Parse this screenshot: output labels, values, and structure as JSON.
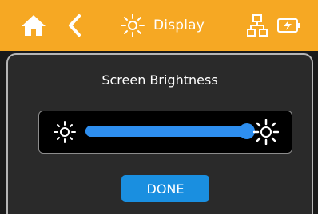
{
  "header": {
    "title": "Display",
    "home_icon": "home-icon",
    "back_icon": "back-chevron-icon",
    "title_icon": "sun-icon",
    "network_icon": "network-icon",
    "battery_icon": "battery-charging-icon"
  },
  "brightness": {
    "label": "Screen Brightness",
    "level": 1.0,
    "min_icon": "sun-low-icon",
    "max_icon": "sun-high-icon"
  },
  "actions": {
    "done_label": "DONE"
  },
  "colors": {
    "accent": "#f6a823",
    "slider": "#2e8ff0",
    "button": "#1a8fe0",
    "background": "#1a1a1a"
  }
}
